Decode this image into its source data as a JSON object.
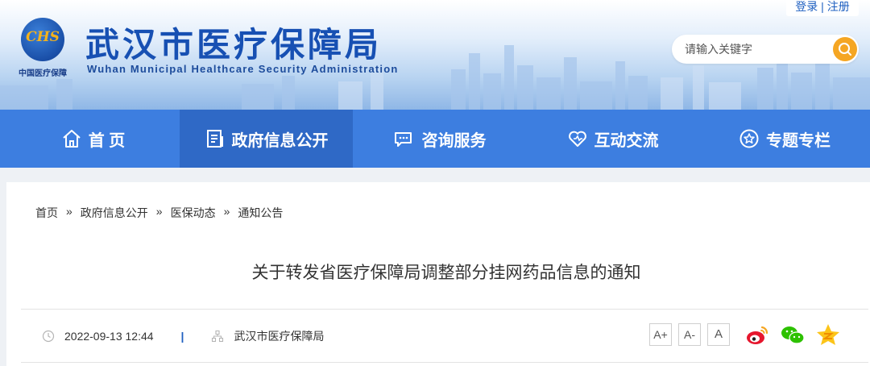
{
  "header": {
    "logo_text": "CHS",
    "logo_sub": "中国医疗保障",
    "title": "武汉市医疗保障局",
    "subtitle": "Wuhan Municipal Healthcare Security Administration",
    "login": "登录",
    "register": "注册",
    "separator": "|",
    "search_placeholder": "请输入关键字"
  },
  "nav": {
    "items": [
      {
        "label": "首 页",
        "icon": "home-icon"
      },
      {
        "label": "政府信息公开",
        "icon": "document-icon",
        "active": true
      },
      {
        "label": "咨询服务",
        "icon": "chat-icon"
      },
      {
        "label": "互动交流",
        "icon": "heart-icon"
      },
      {
        "label": "专题专栏",
        "icon": "star-icon"
      }
    ]
  },
  "breadcrumb": [
    "首页",
    "政府信息公开",
    "医保动态",
    "通知公告"
  ],
  "breadcrumb_sep": "»",
  "article": {
    "title": "关于转发省医疗保障局调整部分挂网药品信息的通知",
    "datetime": "2022-09-13 12:44",
    "meta_sep": "|",
    "source": "武汉市医疗保障局"
  },
  "font_controls": [
    "A+",
    "A-",
    "A"
  ],
  "share": [
    "weibo-icon",
    "wechat-icon",
    "qzone-icon"
  ],
  "colors": {
    "brand_blue": "#1750b3",
    "nav_bg": "#3d7ee0",
    "nav_active": "#2f69c6",
    "search_btn": "#f5a623"
  }
}
